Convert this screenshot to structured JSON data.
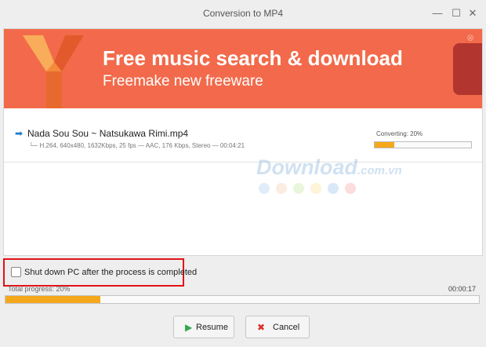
{
  "window": {
    "title": "Conversion to MP4",
    "controls": {
      "minimize": "—",
      "maximize": "☐",
      "close": "✕"
    }
  },
  "ad": {
    "title": "Free music search & download",
    "subtitle": "Freemake new freeware",
    "close_glyph": "⊗",
    "colors": {
      "background": "#f26a4b",
      "side_tab": "#b2362f"
    },
    "logo_icon": "freemake-y-logo-icon"
  },
  "file": {
    "arrow_icon": "➡",
    "name": "Nada Sou Sou ~ Natsukawa Rimi.mp4",
    "details": "└─ H.264, 640x480, 1632Kbps, 25 fps — AAC, 176 Kbps, Stereo — 00:04:21",
    "status_label": "Converting:",
    "status_percent": "20%",
    "progress_fraction": 0.2
  },
  "watermark": {
    "text": "Download",
    "suffix": ".com.vn",
    "dot_colors": [
      "#a9c9ee",
      "#f7c7a8",
      "#c4e59a",
      "#f8df8e",
      "#8fbde6",
      "#f59a9a"
    ]
  },
  "options": {
    "shutdown_label": "Shut down PC after the process is completed",
    "shutdown_checked": false
  },
  "total": {
    "label": "Total progress:",
    "percent": "20%",
    "elapsed": "00:00:17",
    "progress_fraction": 0.2
  },
  "buttons": {
    "resume": {
      "label": "Resume",
      "icon": "▶"
    },
    "cancel": {
      "label": "Cancel",
      "icon": "✖"
    }
  },
  "colors": {
    "progress": "#f5a81c",
    "highlight_border": "#e21218",
    "arrow": "#1b7bd0",
    "resume_icon": "#33a852",
    "cancel_icon": "#d9322b"
  }
}
